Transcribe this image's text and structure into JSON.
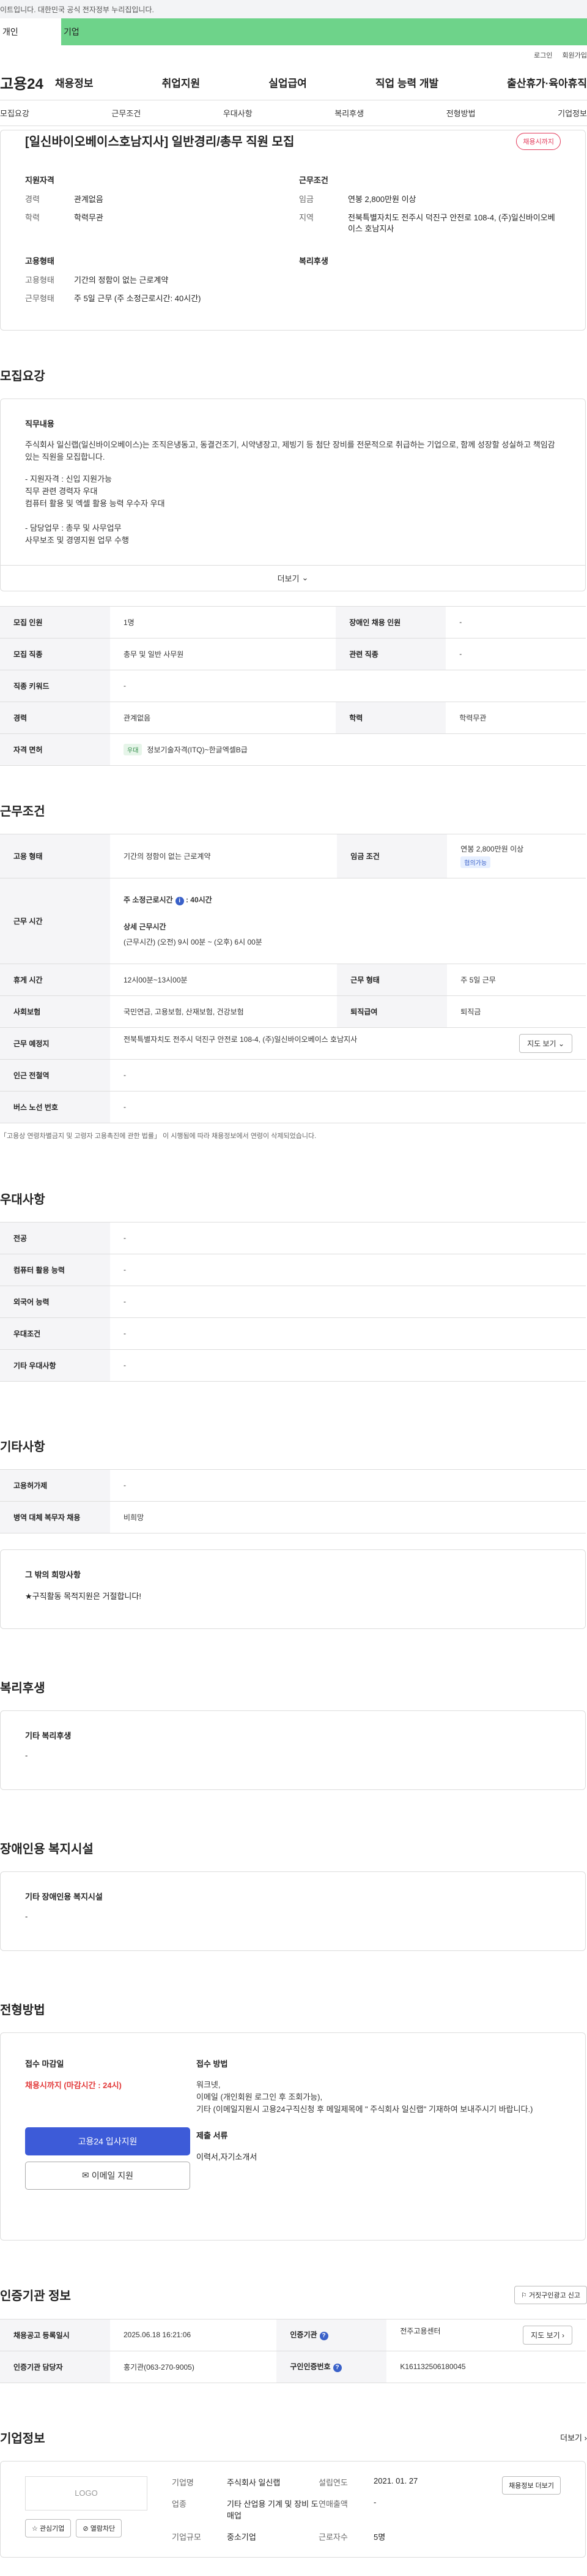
{
  "topbar": {
    "notice": "이트입니다. 대한민국 공식 전자정부 누리집입니다."
  },
  "persona": {
    "personal": "개인",
    "company": "기업"
  },
  "util": {
    "login": "로그인",
    "join": "회원가입"
  },
  "gnb": {
    "logo": "고용24",
    "menu": [
      "채용정보",
      "취업지원",
      "실업급여",
      "직업 능력 개발",
      "출산휴가·육아휴직"
    ]
  },
  "tabs": [
    "모집요강",
    "근무조건",
    "우대사항",
    "복리후생",
    "전형방법",
    "기업정보"
  ],
  "summary": {
    "title": "[일신바이오베이스호남지사] 일반경리/총무 직원 모집",
    "status": "채용시까지",
    "qual_title": "지원자격",
    "career_label": "경력",
    "career": "관계없음",
    "edu_label": "학력",
    "edu": "학력무관",
    "cond_title": "근무조건",
    "wage_label": "임금",
    "wage": "연봉 2,800만원 이상",
    "loc_label": "지역",
    "loc": "전북특별자치도 전주시 덕진구 안전로 108-4, (주)일신바이오베이스 호남지사",
    "emp_title": "고용형태",
    "emptype_label": "고용형태",
    "emptype": "기간의 정함이 없는 근로계약",
    "worktype_label": "근무형태",
    "worktype": "주 5일 근무 (주 소정근로시간: 40시간)",
    "welfare_title": "복리후생"
  },
  "recruit": {
    "title": "모집요강",
    "job_title": "직무내용",
    "job_text": "주식회사 일신랩(일신바이오베이스)는 조직은냉동고, 동결건조기, 시약냉장고, 제빙기 등 첨단 장비를 전문적으로 취급하는 기업으로, 함께 성장할 성실하고 책임감 있는 직원을 모집합니다.",
    "bullets": "- 지원자격 : 신입 지원가능\n     직무 관련 경력자 우대\n     컴퓨터 활용 및 엑셀 활용 능력 우수자 우대\n\n- 담당업무 : 총무 및 사무업무\n     사무보조 및 경영지원 업무 수행",
    "more": "더보기",
    "rows": [
      [
        "모집 인원",
        "1명",
        "장애인 채용 인원",
        "-"
      ],
      [
        "모집 직종",
        "총무 및 일반 사무원",
        "관련 직종",
        "-"
      ]
    ],
    "keyword_label": "직종 키워드",
    "keyword": "-",
    "career_label": "경력",
    "career": "관계없음",
    "edu_label": "학력",
    "edu": "학력무관",
    "cert_label": "자격 면허",
    "cert_tag": "우대",
    "cert": "정보기술자격(ITQ)~한글엑셀B급"
  },
  "work": {
    "title": "근무조건",
    "emp_label": "고용 형태",
    "emp": "기간의 정함이 없는 근로계약",
    "wage_label": "임금 조건",
    "wage": "연봉 2,800만원 이상",
    "wage_tag": "협의가능",
    "time_label": "근무 시간",
    "time_main": "주 소정근로시간",
    "time_val": "40시간",
    "time_detail": "상세 근무시간",
    "time_text": "(근무시간) (오전) 9시 00분 ~ (오후) 6시 00분",
    "break_label": "휴게 시간",
    "break": "12시00분~13시00분",
    "form_label": "근무 형태",
    "form": "주 5일 근무",
    "ins_label": "사회보험",
    "ins": "국민연금, 고용보험, 산재보험, 건강보험",
    "ret_label": "퇴직급여",
    "ret": "퇴직금",
    "place_label": "근무 예정지",
    "place": "전북특별자치도 전주시 덕진구 안전로 108-4, (주)일신바이오베이스 호남지사",
    "map_btn": "지도 보기",
    "subway_label": "인근 전철역",
    "subway": "-",
    "bus_label": "버스 노선 번호",
    "bus": "-",
    "note": "「고용상 연령차별금지 및 고령자 고용촉진에 관한 법률」 이 시행됨에 따라 채용정보에서 연령이 삭제되었습니다."
  },
  "pref": {
    "title": "우대사항",
    "rows": [
      [
        "전공",
        "-"
      ],
      [
        "컴퓨터 활용 능력",
        "-"
      ],
      [
        "외국어 능력",
        "-"
      ],
      [
        "우대조건",
        "-"
      ],
      [
        "기타 우대사항",
        "-"
      ]
    ]
  },
  "etc": {
    "title": "기타사항",
    "rows": [
      [
        "고용허가제",
        "-"
      ],
      [
        "병역 대체 복무자 채용",
        "비희망"
      ]
    ],
    "other_title": "그 밖의 희망사항",
    "other_text": "★구직활동 목적지원은 거절합니다!"
  },
  "welfare": {
    "title": "복리후생",
    "box_title": "기타 복리후생",
    "box_val": "-"
  },
  "disab": {
    "title": "장애인용 복지시설",
    "box_title": "기타 장애인용 복지시설",
    "box_val": "-"
  },
  "apply": {
    "title": "전형방법",
    "deadline_title": "접수 마감일",
    "deadline": "채용시까지 (마감시간 : 24시)",
    "method_title": "접수 방법",
    "method_text": "워크넷,\n이메일 (개인회원 로그인 후 조회가능),\n기타 (이메일지원시 고용24구직신청 후 메일제목에 \" 주식회사 일신랩\" 기재하여 보내주시기 바랍니다.)",
    "docs_title": "제출 서류",
    "docs": "이력서,자기소개서",
    "btn_apply": "고용24 입사지원",
    "btn_email": "이메일 지원"
  },
  "agency": {
    "title": "인증기관 정보",
    "report": "거짓구인광고 신고",
    "reg_label": "채용공고 등록일시",
    "reg": "2025.06.18 16:21:06",
    "org_label": "인증기관",
    "org": "전주고용센터",
    "map_btn": "지도 보기",
    "mgr_label": "인증기관 담당자",
    "mgr": "홍기관(063-270-9005)",
    "num_label": "구인인증번호",
    "num": "K161132506180045"
  },
  "companyinfo": {
    "title": "기업정보",
    "more": "더보기",
    "logo": "LOGO",
    "fav": "관심기업",
    "block": "열람차단",
    "recruit_btn": "채용정보 더보기",
    "name_label": "기업명",
    "name": "주식회사 일신랩",
    "est_label": "설립연도",
    "est": "2021. 01. 27",
    "ind_label": "업종",
    "ind": "기타 산업용 기계 및 장비 도매업",
    "sales_label": "연매출액",
    "sales": "-",
    "scale_label": "기업규모",
    "scale": "중소기업",
    "emp_label": "근로자수",
    "emp": "5명"
  }
}
